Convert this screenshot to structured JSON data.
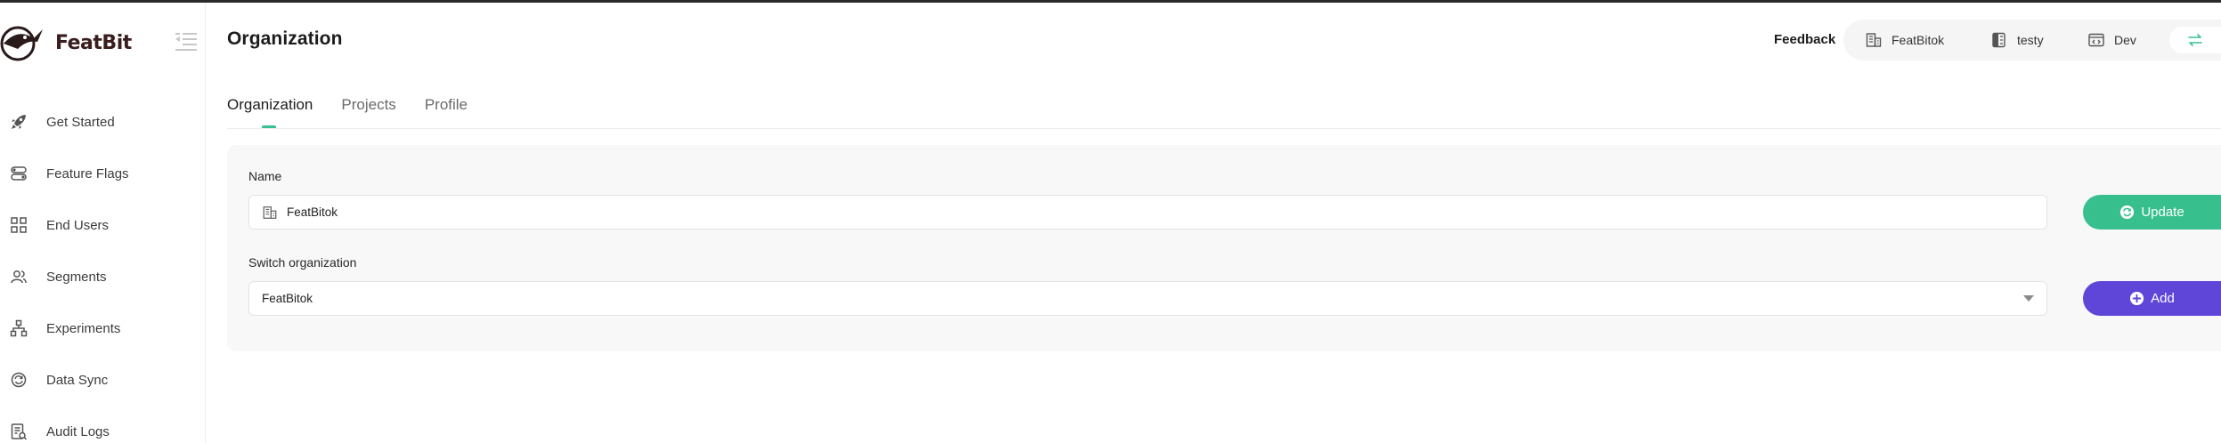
{
  "brand": {
    "name": "FeatBit"
  },
  "sidebar": {
    "items": [
      {
        "label": "Get Started",
        "icon": "rocket-icon"
      },
      {
        "label": "Feature Flags",
        "icon": "toggle-icon"
      },
      {
        "label": "End Users",
        "icon": "grid-icon"
      },
      {
        "label": "Segments",
        "icon": "users-icon"
      },
      {
        "label": "Experiments",
        "icon": "hierarchy-icon"
      },
      {
        "label": "Data Sync",
        "icon": "sync-icon"
      },
      {
        "label": "Audit Logs",
        "icon": "audit-icon"
      }
    ]
  },
  "header": {
    "title": "Organization",
    "feedback": "Feedback",
    "context": {
      "organization": "FeatBitok",
      "project": "testy",
      "environment": "Dev"
    }
  },
  "tabs": [
    {
      "label": "Organization",
      "active": true
    },
    {
      "label": "Projects",
      "active": false
    },
    {
      "label": "Profile",
      "active": false
    }
  ],
  "form": {
    "name_label": "Name",
    "name_value": "FeatBitok",
    "update_label": "Update",
    "switch_label": "Switch organization",
    "switch_value": "FeatBitok",
    "add_label": "Add"
  },
  "colors": {
    "accent_green": "#37c08e",
    "accent_purple": "#5f45d8",
    "brand_text": "#3a1d1d"
  }
}
